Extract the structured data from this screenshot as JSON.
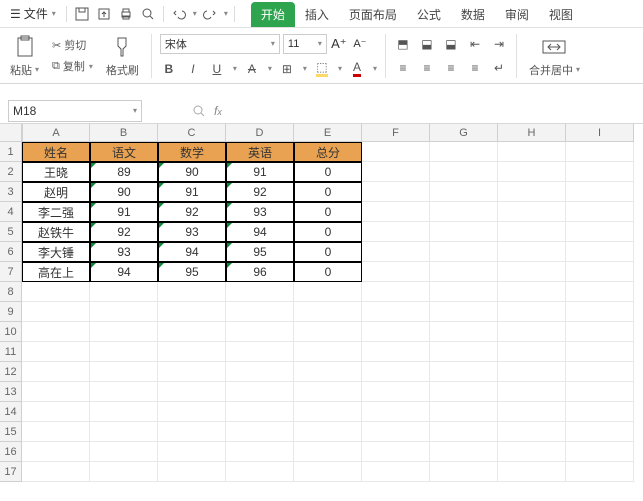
{
  "menu": {
    "file_label": "文件"
  },
  "tabs": {
    "start": "开始",
    "insert": "插入",
    "layout": "页面布局",
    "formula": "公式",
    "data": "数据",
    "review": "审阅",
    "view": "视图"
  },
  "ribbon": {
    "paste": "粘贴",
    "cut": "剪切",
    "copy": "复制",
    "format_painter": "格式刷",
    "font_name": "宋体",
    "font_size": "11",
    "merge_center": "合并居中"
  },
  "namebox": "M18",
  "columns": [
    "A",
    "B",
    "C",
    "D",
    "E",
    "F",
    "G",
    "H",
    "I"
  ],
  "row_numbers": [
    "1",
    "2",
    "3",
    "4",
    "5",
    "6",
    "7",
    "8",
    "9",
    "10",
    "11",
    "12",
    "13",
    "14",
    "15",
    "16",
    "17"
  ],
  "chart_data": {
    "type": "table",
    "headers": [
      "姓名",
      "语文",
      "数学",
      "英语",
      "总分"
    ],
    "rows": [
      [
        "王晓",
        "89",
        "90",
        "91",
        "0"
      ],
      [
        "赵明",
        "90",
        "91",
        "92",
        "0"
      ],
      [
        "李二强",
        "91",
        "92",
        "93",
        "0"
      ],
      [
        "赵铁牛",
        "92",
        "93",
        "94",
        "0"
      ],
      [
        "李大锤",
        "93",
        "94",
        "95",
        "0"
      ],
      [
        "高在上",
        "94",
        "95",
        "96",
        "0"
      ]
    ]
  }
}
